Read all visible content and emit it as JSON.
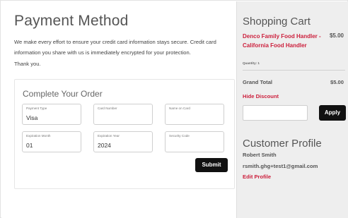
{
  "payment": {
    "title": "Payment Method",
    "intro": "We make every effort to ensure your credit card information stays secure. Credit card information you share with us is immediately encrypted for your protection.",
    "thanks": "Thank you."
  },
  "order": {
    "title": "Complete Your Order",
    "fields": {
      "payment_type": {
        "label": "Payment Type",
        "value": "Visa"
      },
      "card_number": {
        "label": "Card Number",
        "value": ""
      },
      "name_on_card": {
        "label": "Name on Card",
        "value": ""
      },
      "expiration_month": {
        "label": "Expiration Month",
        "value": "01"
      },
      "expiration_year": {
        "label": "Expiration Year",
        "value": "2024"
      },
      "security_code": {
        "label": "Security Code",
        "value": ""
      }
    },
    "submit_label": "Submit"
  },
  "cart": {
    "title": "Shopping Cart",
    "item": {
      "name": "Denco Family Food Handler - California Food Handler",
      "price": "$5.00",
      "quantity": "Quantity: 1"
    },
    "grand_total_label": "Grand Total",
    "grand_total_value": "$5.00",
    "hide_discount": "Hide Discount",
    "discount_input_value": "",
    "apply_label": "Apply"
  },
  "profile": {
    "title": "Customer Profile",
    "name": "Robert Smith",
    "email": "rsmith.ghg+test1@gmail.com",
    "edit_label": "Edit Profile"
  },
  "colors": {
    "accent": "#cc1f3c",
    "sidebar_bg": "#eeeeee",
    "button_bg": "#111111"
  }
}
